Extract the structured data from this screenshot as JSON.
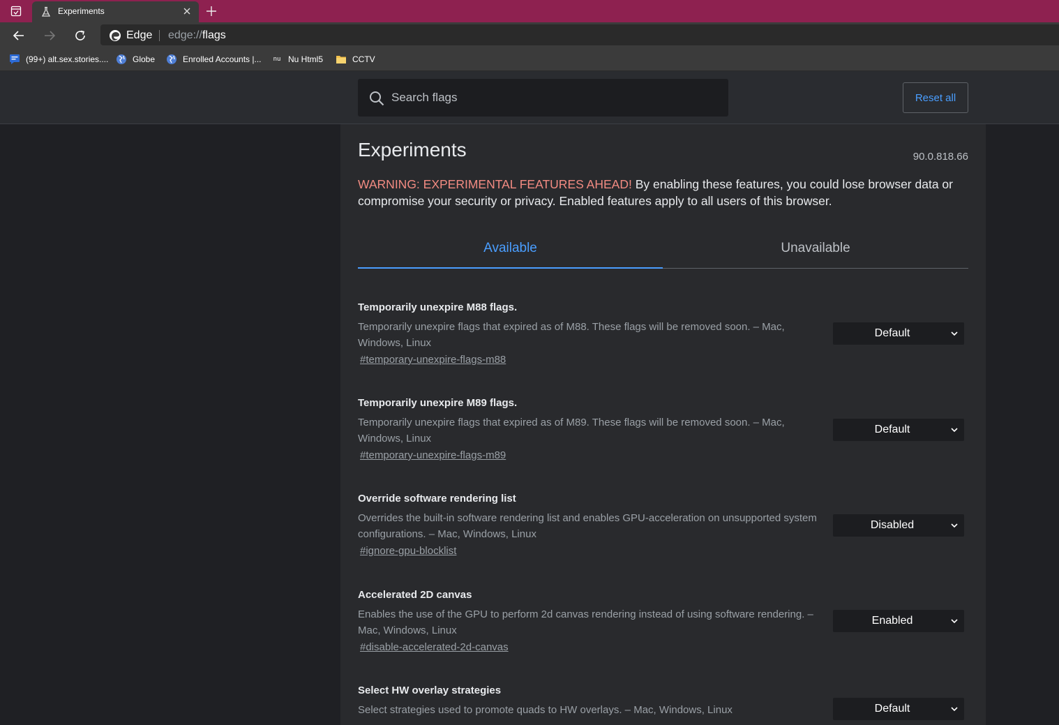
{
  "browser": {
    "tab": {
      "title": "Experiments"
    },
    "address": {
      "brand": "Edge",
      "scheme": "edge://",
      "path": "flags"
    },
    "bookmarks": [
      {
        "label": "(99+) alt.sex.stories...."
      },
      {
        "label": "Globe"
      },
      {
        "label": "Enrolled Accounts |..."
      },
      {
        "label": "Nu Html5",
        "icon_text": "nu"
      },
      {
        "label": "CCTV"
      }
    ],
    "colors": {
      "tabstrip": "#8e2150",
      "accent": "#4a9eff",
      "warning": "#f28b82"
    }
  },
  "header": {
    "search_placeholder": "Search flags",
    "reset_label": "Reset all"
  },
  "page": {
    "title": "Experiments",
    "version": "90.0.818.66",
    "warning_strong": "WARNING: EXPERIMENTAL FEATURES AHEAD!",
    "warning_text": " By enabling these features, you could lose browser data or compromise your security or privacy. Enabled features apply to all users of this browser.",
    "tabs": [
      {
        "label": "Available",
        "selected": true
      },
      {
        "label": "Unavailable",
        "selected": false
      }
    ]
  },
  "flags": [
    {
      "name": "Temporarily unexpire M88 flags.",
      "description": "Temporarily unexpire flags that expired as of M88. These flags will be removed soon. – Mac, Windows, Linux",
      "link": "#temporary-unexpire-flags-m88",
      "value": "Default"
    },
    {
      "name": "Temporarily unexpire M89 flags.",
      "description": "Temporarily unexpire flags that expired as of M89. These flags will be removed soon. – Mac, Windows, Linux",
      "link": "#temporary-unexpire-flags-m89",
      "value": "Default"
    },
    {
      "name": "Override software rendering list",
      "description": "Overrides the built-in software rendering list and enables GPU-acceleration on unsupported system configurations. – Mac, Windows, Linux",
      "link": "#ignore-gpu-blocklist",
      "value": "Disabled"
    },
    {
      "name": "Accelerated 2D canvas",
      "description": "Enables the use of the GPU to perform 2d canvas rendering instead of using software rendering. – Mac, Windows, Linux",
      "link": "#disable-accelerated-2d-canvas",
      "value": "Enabled"
    },
    {
      "name": "Select HW overlay strategies",
      "description": "Select strategies used to promote quads to HW overlays. – Mac, Windows, Linux",
      "link": "",
      "value": "Default"
    }
  ]
}
